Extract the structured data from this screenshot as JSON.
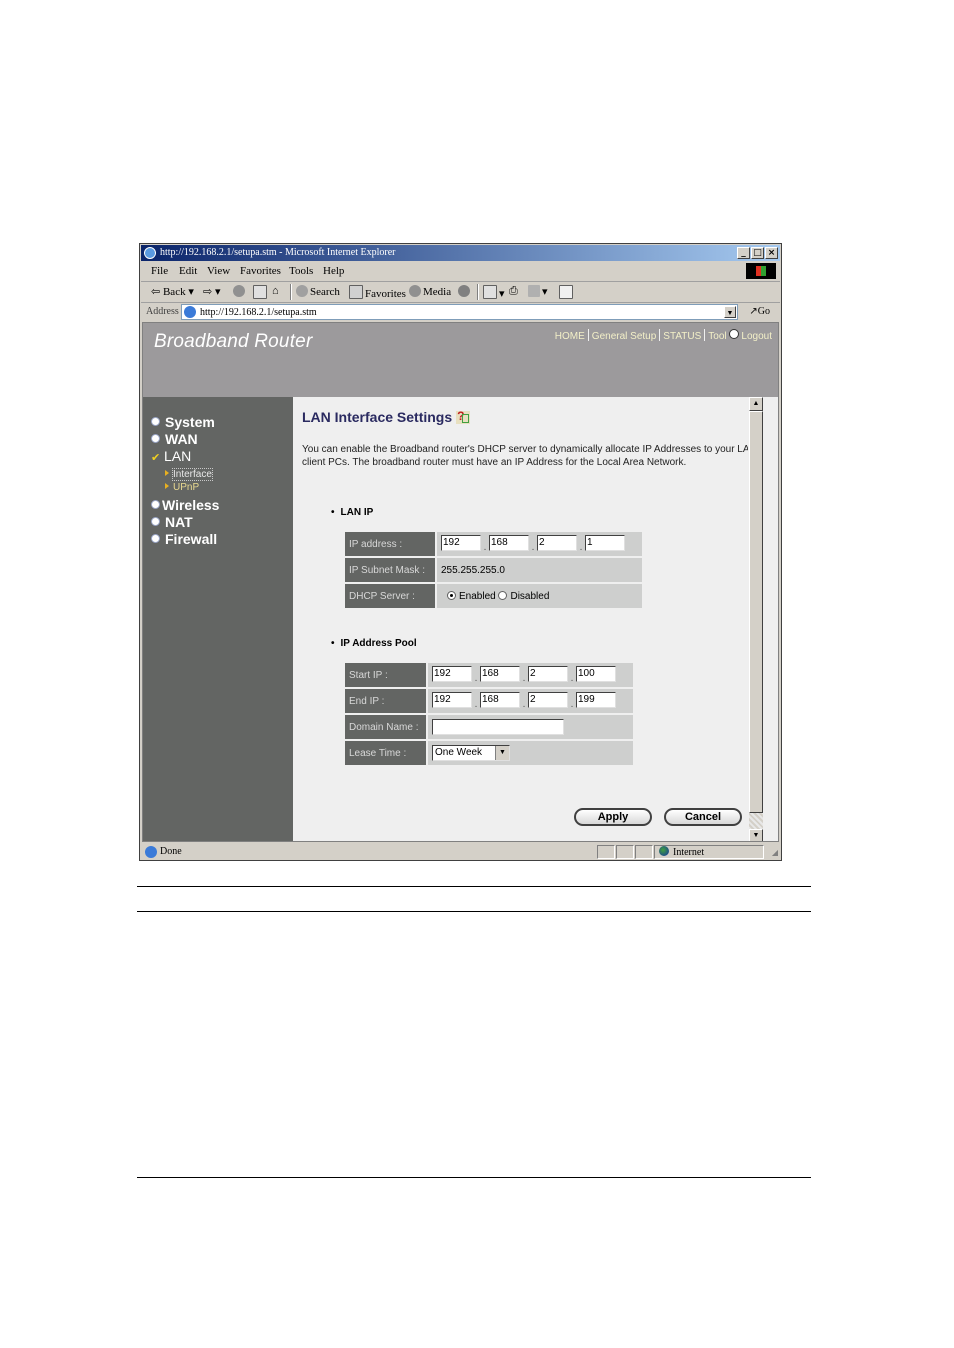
{
  "browser": {
    "title": "http://192.168.2.1/setupa.stm - Microsoft Internet Explorer",
    "window_buttons": [
      "_",
      "□",
      "×"
    ],
    "menu": [
      "File",
      "Edit",
      "View",
      "Favorites",
      "Tools",
      "Help"
    ],
    "toolbar": {
      "back": "Back",
      "search": "Search",
      "favorites": "Favorites",
      "media": "Media"
    },
    "address": {
      "label": "Address",
      "url": "http://192.168.2.1/setupa.stm",
      "go": "Go"
    },
    "status": {
      "text": "Done",
      "zone": "Internet"
    }
  },
  "router": {
    "brand": "Broadband Router",
    "topnav": [
      "HOME",
      "General Setup",
      "STATUS",
      "Tool",
      "Logout"
    ],
    "sidebar": {
      "items": [
        {
          "label": "System",
          "icon": "bullet"
        },
        {
          "label": "WAN",
          "icon": "bullet"
        },
        {
          "label": "LAN",
          "icon": "check",
          "active": true
        },
        {
          "label": "Wireless",
          "icon": "bullet"
        },
        {
          "label": "NAT",
          "icon": "bullet"
        },
        {
          "label": "Firewall",
          "icon": "bullet"
        }
      ],
      "sub_items": [
        {
          "label": "Interface",
          "active": true
        },
        {
          "label": "UPnP"
        }
      ]
    },
    "page": {
      "title": "LAN Interface Settings",
      "description": "You can enable the Broadband router's DHCP server to dynamically allocate IP Addresses to your LAN client PCs. The broadband router must have an IP Address for the Local Area Network.",
      "lan_ip": {
        "heading": "LAN IP",
        "ip_label": "IP address :",
        "ip": [
          "192",
          "168",
          "2",
          "1"
        ],
        "mask_label": "IP Subnet Mask :",
        "mask": "255.255.255.0",
        "dhcp_label": "DHCP Server :",
        "dhcp_enabled": "Enabled",
        "dhcp_disabled": "Disabled",
        "dhcp_selected": "Enabled"
      },
      "pool": {
        "heading": "IP Address Pool",
        "start_label": "Start IP :",
        "start": [
          "192",
          "168",
          "2",
          "100"
        ],
        "end_label": "End IP :",
        "end": [
          "192",
          "168",
          "2",
          "199"
        ],
        "domain_label": "Domain Name :",
        "domain": "",
        "lease_label": "Lease Time :",
        "lease": "One Week"
      },
      "apply": "Apply",
      "cancel": "Cancel"
    }
  }
}
